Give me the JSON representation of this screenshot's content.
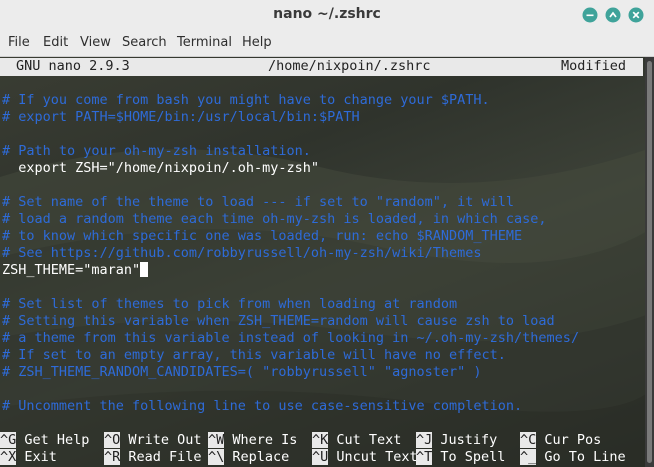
{
  "window": {
    "title": "nano ~/.zshrc"
  },
  "menubar": {
    "items": [
      "File",
      "Edit",
      "View",
      "Search",
      "Terminal",
      "Help"
    ]
  },
  "nano": {
    "version": "GNU nano 2.9.3",
    "filepath": "/home/nixpoin/.zshrc",
    "status": "Modified"
  },
  "editor": {
    "lines": [
      {
        "text": "# If you come from bash you might have to change your $PATH.",
        "type": "comment"
      },
      {
        "text": "# export PATH=$HOME/bin:/usr/local/bin:$PATH",
        "type": "comment"
      },
      {
        "text": "",
        "type": "blank"
      },
      {
        "text": "# Path to your oh-my-zsh installation.",
        "type": "comment"
      },
      {
        "text": "  export ZSH=\"/home/nixpoin/.oh-my-zsh\"",
        "type": "code"
      },
      {
        "text": "",
        "type": "blank"
      },
      {
        "text": "# Set name of the theme to load --- if set to \"random\", it will",
        "type": "comment"
      },
      {
        "text": "# load a random theme each time oh-my-zsh is loaded, in which case,",
        "type": "comment"
      },
      {
        "text": "# to know which specific one was loaded, run: echo $RANDOM_THEME",
        "type": "comment"
      },
      {
        "text": "# See https://github.com/robbyrussell/oh-my-zsh/wiki/Themes",
        "type": "comment"
      },
      {
        "text": "ZSH_THEME=\"maran\"",
        "type": "code"
      },
      {
        "text": "",
        "type": "blank"
      },
      {
        "text": "# Set list of themes to pick from when loading at random",
        "type": "comment"
      },
      {
        "text": "# Setting this variable when ZSH_THEME=random will cause zsh to load",
        "type": "comment"
      },
      {
        "text": "# a theme from this variable instead of looking in ~/.oh-my-zsh/themes/",
        "type": "comment"
      },
      {
        "text": "# If set to an empty array, this variable will have no effect.",
        "type": "comment"
      },
      {
        "text": "# ZSH_THEME_RANDOM_CANDIDATES=( \"robbyrussell\" \"agnoster\" )",
        "type": "comment"
      },
      {
        "text": "",
        "type": "blank"
      },
      {
        "text": "# Uncomment the following line to use case-sensitive completion.",
        "type": "comment"
      }
    ]
  },
  "shortcuts": [
    {
      "key": "^G",
      "label": "Get Help"
    },
    {
      "key": "^O",
      "label": "Write Out"
    },
    {
      "key": "^W",
      "label": "Where Is"
    },
    {
      "key": "^K",
      "label": "Cut Text"
    },
    {
      "key": "^J",
      "label": "Justify"
    },
    {
      "key": "^C",
      "label": "Cur Pos"
    },
    {
      "key": "^X",
      "label": "Exit"
    },
    {
      "key": "^R",
      "label": "Read File"
    },
    {
      "key": "^\\",
      "label": "Replace"
    },
    {
      "key": "^U",
      "label": "Uncut Text"
    },
    {
      "key": "^T",
      "label": "To Spell"
    },
    {
      "key": "^_",
      "label": "Go To Line"
    }
  ],
  "colors": {
    "comment": "#2e6bd8",
    "status_bg": "#e9e9e9",
    "window_controls": "#3fa39a"
  },
  "icons": [
    "minimize-icon",
    "maximize-icon",
    "close-icon"
  ]
}
